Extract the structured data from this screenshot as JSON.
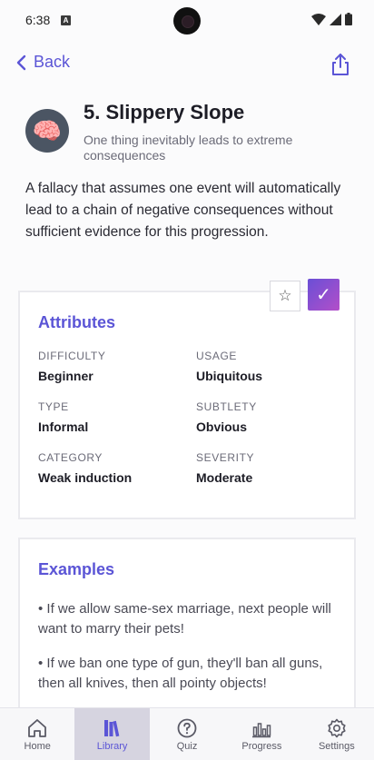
{
  "status": {
    "time": "6:38",
    "notification_glyph": "A"
  },
  "header": {
    "back_label": "Back"
  },
  "fallacy": {
    "title": "5. Slippery Slope",
    "subtitle": "One thing inevitably leads to extreme consequences",
    "avatar_emoji": "🧠",
    "description": "A fallacy that assumes one event will automatically lead to a chain of negative consequences without sufficient evidence for this progression."
  },
  "actions": {
    "favorite_glyph": "☆",
    "done_glyph": "✓"
  },
  "attributes": {
    "heading": "Attributes",
    "items": [
      {
        "label": "DIFFICULTY",
        "value": "Beginner"
      },
      {
        "label": "USAGE",
        "value": "Ubiquitous"
      },
      {
        "label": "TYPE",
        "value": "Informal"
      },
      {
        "label": "SUBTLETY",
        "value": "Obvious"
      },
      {
        "label": "CATEGORY",
        "value": "Weak induction"
      },
      {
        "label": "SEVERITY",
        "value": "Moderate"
      }
    ]
  },
  "examples": {
    "heading": "Examples",
    "items": [
      "•  If we allow same-sex marriage, next people will want to marry their pets!",
      "•  If we ban one type of gun, they'll ban all guns, then all knives, then all pointy objects!"
    ]
  },
  "nav": {
    "items": [
      {
        "label": "Home",
        "icon": "home-icon"
      },
      {
        "label": "Library",
        "icon": "library-icon",
        "active": true
      },
      {
        "label": "Quiz",
        "icon": "quiz-icon"
      },
      {
        "label": "Progress",
        "icon": "progress-icon"
      },
      {
        "label": "Settings",
        "icon": "settings-icon"
      }
    ]
  },
  "colors": {
    "accent": "#5b55d6",
    "done_gradient_start": "#6a4fd6",
    "done_gradient_end": "#b34fc9"
  }
}
